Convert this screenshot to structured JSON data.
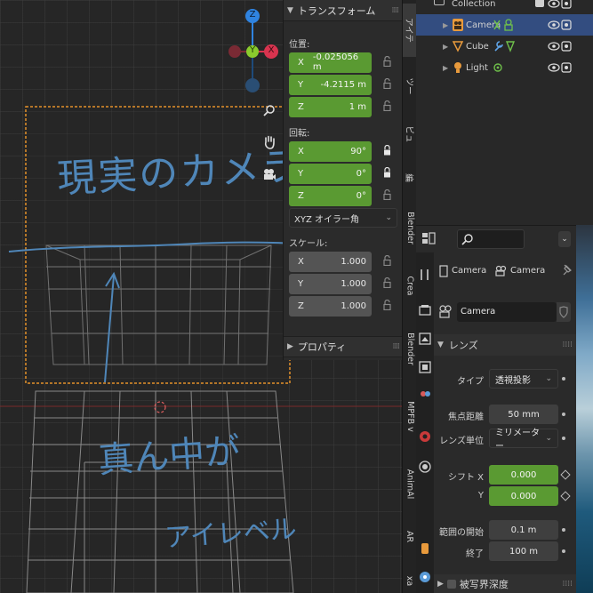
{
  "npanel": {
    "transform_title": "トランスフォーム",
    "location_label": "位置:",
    "location": [
      {
        "axis": "X",
        "value": "-0.025056 m"
      },
      {
        "axis": "Y",
        "value": "-4.2115 m"
      },
      {
        "axis": "Z",
        "value": "1 m"
      }
    ],
    "rotation_label": "回転:",
    "rotation": [
      {
        "axis": "X",
        "value": "90°"
      },
      {
        "axis": "Y",
        "value": "0°"
      },
      {
        "axis": "Z",
        "value": "0°"
      }
    ],
    "rotation_mode": "XYZ オイラー角",
    "scale_label": "スケール:",
    "scale": [
      {
        "axis": "X",
        "value": "1.000"
      },
      {
        "axis": "Y",
        "value": "1.000"
      },
      {
        "axis": "Z",
        "value": "1.000"
      }
    ],
    "properties_title": "プロパティ"
  },
  "tabs": [
    "アイテ",
    "ツー",
    "ビュ",
    "編",
    "Blender",
    "Crea",
    "Blender",
    "MPFB v",
    "AnimAl",
    "AR",
    "xa"
  ],
  "gizmo": {
    "z": "Z",
    "y": "Y",
    "x": "X"
  },
  "outliner": {
    "collection_label": "Collection",
    "items": [
      {
        "label": "Camera",
        "selected": true
      },
      {
        "label": "Cube",
        "selected": false
      },
      {
        "label": "Light",
        "selected": false
      }
    ]
  },
  "properties": {
    "search_placeholder": "",
    "breadcrumb_object": "Camera",
    "breadcrumb_data": "Camera",
    "datablock_name": "Camera",
    "lens_title": "レンズ",
    "type_label": "タイプ",
    "type_value": "透視投影",
    "focal_label": "焦点距離",
    "focal_value": "50 mm",
    "lens_unit_label": "レンズ単位",
    "lens_unit_value": "ミリメーター",
    "shift_x_label": "シフト X",
    "shift_x_value": "0.000",
    "shift_y_label": "Y",
    "shift_y_value": "0.000",
    "clip_start_label": "範囲の開始",
    "clip_start_value": "0.1 m",
    "clip_end_label": "終了",
    "clip_end_value": "100 m",
    "dof_title": "被写界深度"
  },
  "annotations": {
    "top": "現実のカメラ",
    "bottom_line1": "真ん中が",
    "bottom_line2": "アイレベル"
  },
  "colors": {
    "selection_blue": "#334d80",
    "field_green": "#5a9a32",
    "camera_frame_orange": "#e3902a",
    "handwriting_blue": "#4f86b8",
    "gizmo_x": "#d8344f",
    "gizmo_y": "#8acb2d",
    "gizmo_z": "#2f83e0"
  }
}
